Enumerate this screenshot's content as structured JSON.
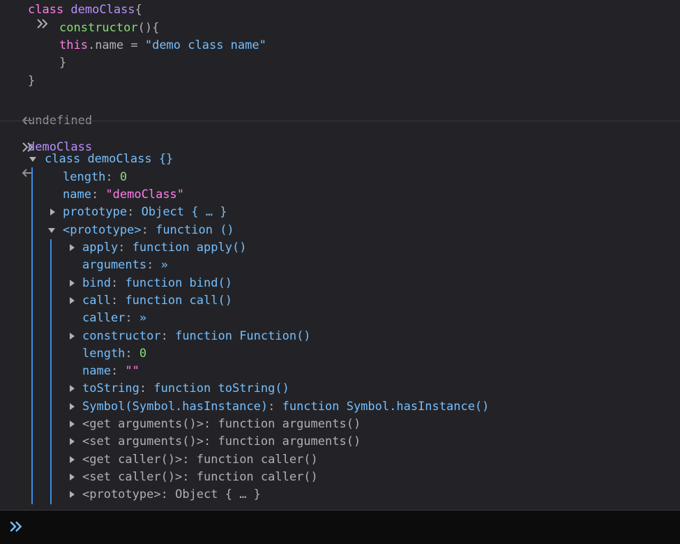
{
  "entry1": {
    "lines": [
      {
        "parts": [
          {
            "t": "class ",
            "c": "kw"
          },
          {
            "t": "demoClass",
            "c": "id"
          },
          {
            "t": "{",
            "c": "plain"
          }
        ]
      },
      {
        "parts": [
          {
            "t": "constructor",
            "c": "num"
          },
          {
            "t": "(){",
            "c": "plain"
          }
        ]
      },
      {
        "parts": [
          {
            "t": "this",
            "c": "kw"
          },
          {
            "t": ".name = ",
            "c": "plain"
          },
          {
            "t": "\"demo class name\"",
            "c": "fn"
          }
        ]
      },
      {
        "parts": [
          {
            "t": "}",
            "c": "plain"
          }
        ]
      },
      {
        "parts": [
          {
            "t": "}",
            "c": "plain"
          }
        ]
      }
    ],
    "result": "undefined"
  },
  "entry2": {
    "input": "demoClass",
    "header": {
      "kw": "class",
      "name": "demoClass",
      "body": "{}"
    },
    "props": {
      "length_key": "length",
      "length_val": "0",
      "name_key": "name",
      "name_val": "\"demoClass\"",
      "prototype_key": "prototype",
      "prototype_val": "Object { … }",
      "proto_key": "<prototype>",
      "proto_val": "function ()"
    },
    "proto_items": [
      {
        "key": "apply",
        "sep": ": ",
        "val": "function apply()",
        "expand": true,
        "dim": false
      },
      {
        "key": "arguments",
        "sep": ": ",
        "val": "»",
        "expand": false,
        "dim": false
      },
      {
        "key": "bind",
        "sep": ": ",
        "val": "function bind()",
        "expand": true,
        "dim": false
      },
      {
        "key": "call",
        "sep": ": ",
        "val": "function call()",
        "expand": true,
        "dim": false
      },
      {
        "key": "caller",
        "sep": ": ",
        "val": "»",
        "expand": false,
        "dim": false
      },
      {
        "key": "constructor",
        "sep": ": ",
        "val": "function Function()",
        "expand": true,
        "dim": false
      },
      {
        "key": "length",
        "sep": ": ",
        "val": "0",
        "expand": false,
        "dim": false,
        "num": true
      },
      {
        "key": "name",
        "sep": ": ",
        "val": "\"\"",
        "expand": false,
        "dim": false,
        "str": true
      },
      {
        "key": "toString",
        "sep": ": ",
        "val": "function toString()",
        "expand": true,
        "dim": false
      },
      {
        "key": "Symbol(Symbol.hasInstance)",
        "sep": ": ",
        "val": "function Symbol.hasInstance()",
        "expand": true,
        "dim": false
      },
      {
        "key": "<get arguments()>",
        "sep": ": ",
        "val": "function arguments()",
        "expand": true,
        "dim": true
      },
      {
        "key": "<set arguments()>",
        "sep": ": ",
        "val": "function arguments()",
        "expand": true,
        "dim": true
      },
      {
        "key": "<get caller()>",
        "sep": ": ",
        "val": "function caller()",
        "expand": true,
        "dim": true
      },
      {
        "key": "<set caller()>",
        "sep": ": ",
        "val": "function caller()",
        "expand": true,
        "dim": true
      },
      {
        "key": "<prototype>",
        "sep": ": ",
        "val": "Object { … }",
        "expand": true,
        "dim": true
      }
    ]
  },
  "colors": {
    "accent": "#3b8ee6",
    "keyword": "#ff7de9",
    "function": "#75bfff",
    "identifier": "#b98eff",
    "number": "#86de74"
  }
}
